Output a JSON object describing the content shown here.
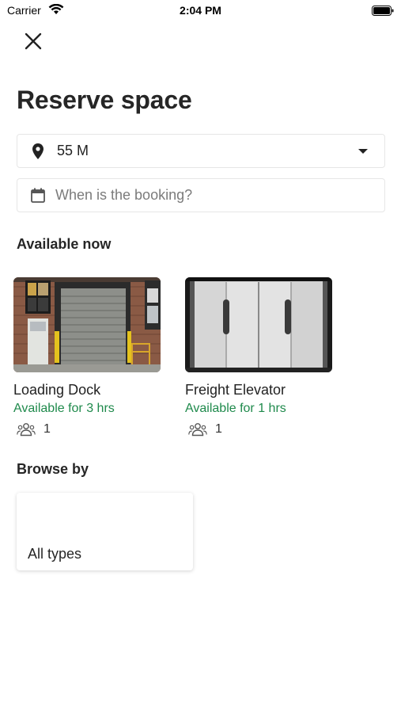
{
  "status_bar": {
    "carrier": "Carrier",
    "time": "2:04 PM",
    "wifi_icon": "wifi-icon",
    "battery_icon": "battery-icon"
  },
  "header": {
    "close_icon": "close-icon",
    "title": "Reserve space"
  },
  "location": {
    "icon": "map-pin-icon",
    "value": "55 M",
    "dropdown_icon": "caret-down-icon"
  },
  "booking": {
    "icon": "calendar-icon",
    "placeholder": "When is the booking?",
    "value": ""
  },
  "available_now": {
    "heading": "Available now",
    "spaces": [
      {
        "name": "Loading Dock",
        "availability": "Available for 3 hrs",
        "capacity": "1",
        "image": "loading-dock-photo"
      },
      {
        "name": "Freight Elevator",
        "availability": "Available for 1 hrs",
        "capacity": "1",
        "image": "freight-elevator-photo"
      }
    ]
  },
  "browse_by": {
    "heading": "Browse by",
    "types": [
      {
        "label": "All types"
      }
    ]
  },
  "colors": {
    "accent_green": "#1f8a4c",
    "text_dark": "#262626",
    "border": "#e6e6e6"
  }
}
